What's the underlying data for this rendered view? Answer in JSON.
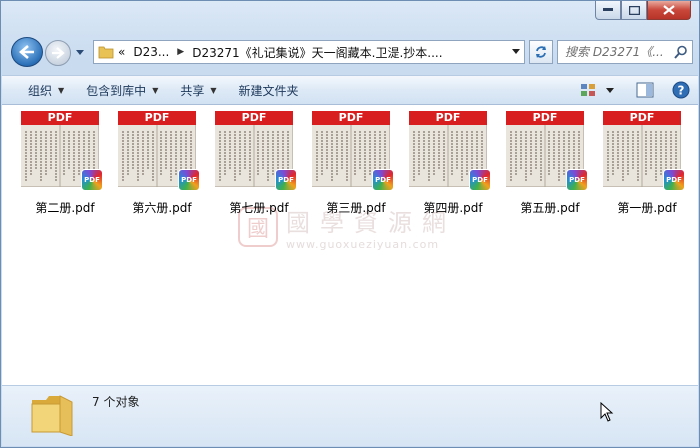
{
  "window": {
    "caption": {
      "minimize_label": "–",
      "maximize_label": "□",
      "close_label": "×"
    }
  },
  "address": {
    "crumb_root": "D23...",
    "crumb_current": "D23271《礼记集说》天一阁藏本.卫湜.抄本....",
    "prefix": "«"
  },
  "search": {
    "placeholder": "搜索 D23271《..."
  },
  "toolbar": {
    "organize": "组织",
    "include_library": "包含到库中",
    "share": "共享",
    "new_folder": "新建文件夹"
  },
  "files": [
    {
      "name": "第二册.pdf",
      "banner": "PDF",
      "badge": "PDF"
    },
    {
      "name": "第六册.pdf",
      "banner": "PDF",
      "badge": "PDF"
    },
    {
      "name": "第七册.pdf",
      "banner": "PDF",
      "badge": "PDF"
    },
    {
      "name": "第三册.pdf",
      "banner": "PDF",
      "badge": "PDF"
    },
    {
      "name": "第四册.pdf",
      "banner": "PDF",
      "badge": "PDF"
    },
    {
      "name": "第五册.pdf",
      "banner": "PDF",
      "badge": "PDF"
    },
    {
      "name": "第一册.pdf",
      "banner": "PDF",
      "badge": "PDF"
    }
  ],
  "watermark": {
    "seal": "國",
    "title": "國學資源網",
    "url": "www.guoxueziyuan.com"
  },
  "details": {
    "count": "7 个对象"
  },
  "colors": {
    "pdf_red": "#d81e1e",
    "content_bg": "#ffffff",
    "chrome": "#c8dbef"
  }
}
